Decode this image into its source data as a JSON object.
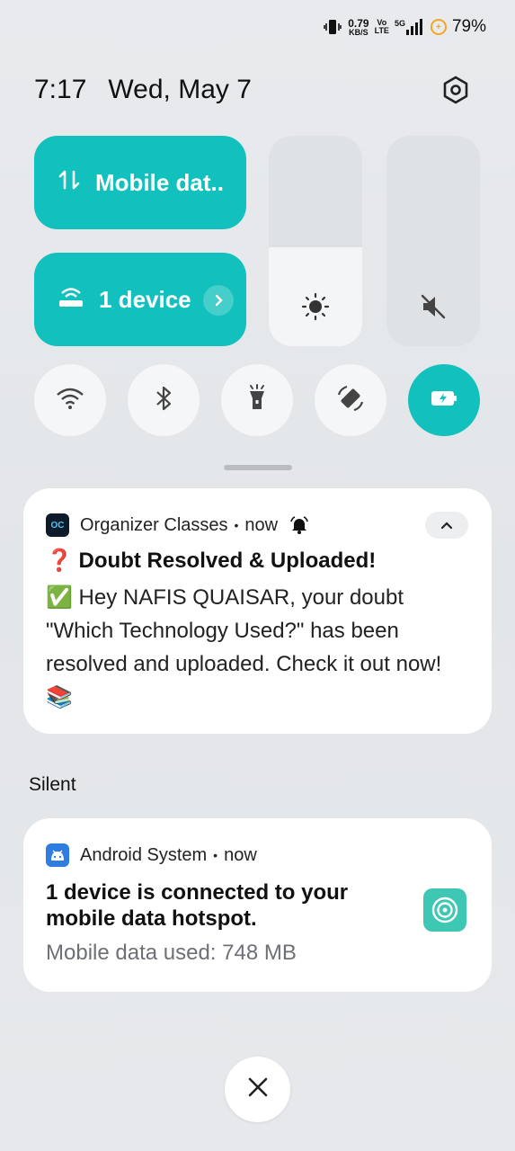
{
  "status_bar": {
    "net_speed_value": "0.79",
    "net_speed_unit": "KB/S",
    "volte_top": "Vo",
    "volte_bottom": "LTE",
    "network_type": "5G",
    "battery_percent": "79%",
    "icons": [
      "vibrate-icon",
      "volte-icon",
      "signal-icon",
      "battery-saver-icon"
    ]
  },
  "header": {
    "time": "7:17",
    "date": "Wed, May 7",
    "settings_icon": "gear-icon"
  },
  "quick_tiles": {
    "mobile_data": {
      "label": "Mobile dat..",
      "icon": "data-arrows-icon"
    },
    "hotspot": {
      "label": "1 device",
      "icon": "hotspot-icon"
    },
    "brightness": {
      "level": 0.47,
      "icon": "sun-icon"
    },
    "volume": {
      "level": 0.0,
      "icon": "mute-icon"
    },
    "toggles": [
      {
        "name": "wifi",
        "icon": "wifi-icon",
        "active": false
      },
      {
        "name": "bluetooth",
        "icon": "bluetooth-icon",
        "active": false
      },
      {
        "name": "flashlight",
        "icon": "flashlight-icon",
        "active": false
      },
      {
        "name": "auto-rotate",
        "icon": "rotate-icon",
        "active": false
      },
      {
        "name": "battery-saver",
        "icon": "battery-charge-icon",
        "active": true
      }
    ]
  },
  "notifications": [
    {
      "app": "Organizer Classes",
      "app_icon_text": "OC",
      "time": "now",
      "separator": "•",
      "title": "❓ Doubt Resolved & Uploaded!",
      "body": "✅ Hey NAFIS QUAISAR, your doubt \"Which Technology Used?\" has been resolved and uploaded. Check it out now! 📚"
    }
  ],
  "silent_section": {
    "label": "Silent",
    "notification": {
      "app": "Android System",
      "time": "now",
      "separator": "•",
      "title": "1 device is connected to your mobile data hotspot.",
      "subtitle": "Mobile data used: 748 MB"
    }
  },
  "colors": {
    "accent": "#12c0bd",
    "hotspot_icon_bg": "#3ec7b3",
    "android_icon_bg": "#2f7de1",
    "battery_ring": "#f5a623"
  }
}
